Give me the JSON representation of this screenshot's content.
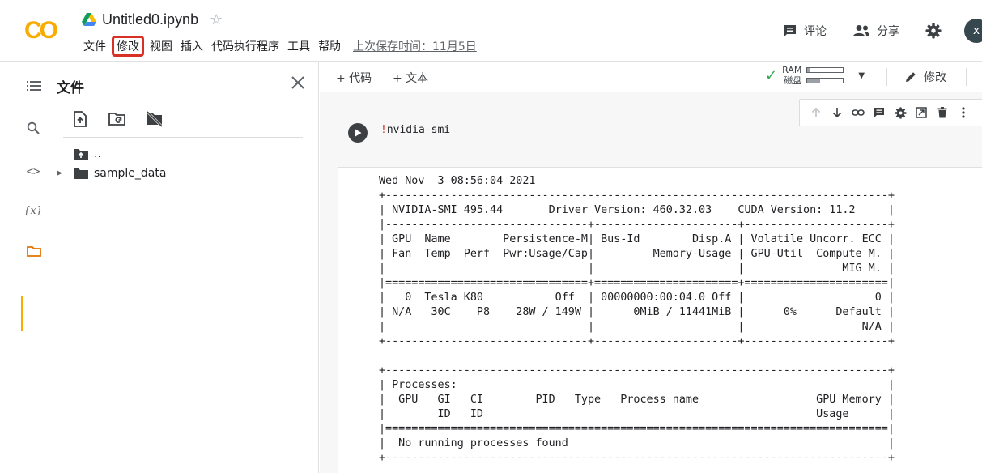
{
  "header": {
    "logo_text": "CO",
    "doc_title": "Untitled0.ipynb",
    "menu": [
      "文件",
      "修改",
      "视图",
      "插入",
      "代码执行程序",
      "工具",
      "帮助"
    ],
    "highlighted_menu": "修改",
    "last_saved": "上次保存时间：11月5日",
    "comment_label": "评论",
    "share_label": "分享",
    "avatar_letter": "x"
  },
  "sidebar": {
    "files_title": "文件",
    "tree": [
      {
        "label": "..",
        "type": "parent"
      },
      {
        "label": "sample_data",
        "type": "folder"
      }
    ]
  },
  "toolbar": {
    "add_code": "+ 代码",
    "add_text": "+ 文本",
    "ram_label": "RAM",
    "disk_label": "磁盘",
    "ram_usage": 0.05,
    "disk_usage": 0.35,
    "edit_label": "修改"
  },
  "cell": {
    "code_bang": "!",
    "code_rest": "nvidia-smi",
    "output": [
      "Wed Nov  3 08:56:04 2021",
      "+-----------------------------------------------------------------------------+",
      "| NVIDIA-SMI 495.44       Driver Version: 460.32.03    CUDA Version: 11.2     |",
      "|-------------------------------+----------------------+----------------------+",
      "| GPU  Name        Persistence-M| Bus-Id        Disp.A | Volatile Uncorr. ECC |",
      "| Fan  Temp  Perf  Pwr:Usage/Cap|         Memory-Usage | GPU-Util  Compute M. |",
      "|                               |                      |               MIG M. |",
      "|===============================+======================+======================|",
      "|   0  Tesla K80           Off  | 00000000:00:04.0 Off |                    0 |",
      "| N/A   30C    P8    28W / 149W |      0MiB / 11441MiB |      0%      Default |",
      "|                               |                      |                  N/A |",
      "+-------------------------------+----------------------+----------------------+",
      "",
      "+-----------------------------------------------------------------------------+",
      "| Processes:                                                                  |",
      "|  GPU   GI   CI        PID   Type   Process name                  GPU Memory |",
      "|        ID   ID                                                   Usage      |",
      "|=============================================================================|",
      "|  No running processes found                                                 |",
      "+-----------------------------------------------------------------------------+"
    ]
  }
}
